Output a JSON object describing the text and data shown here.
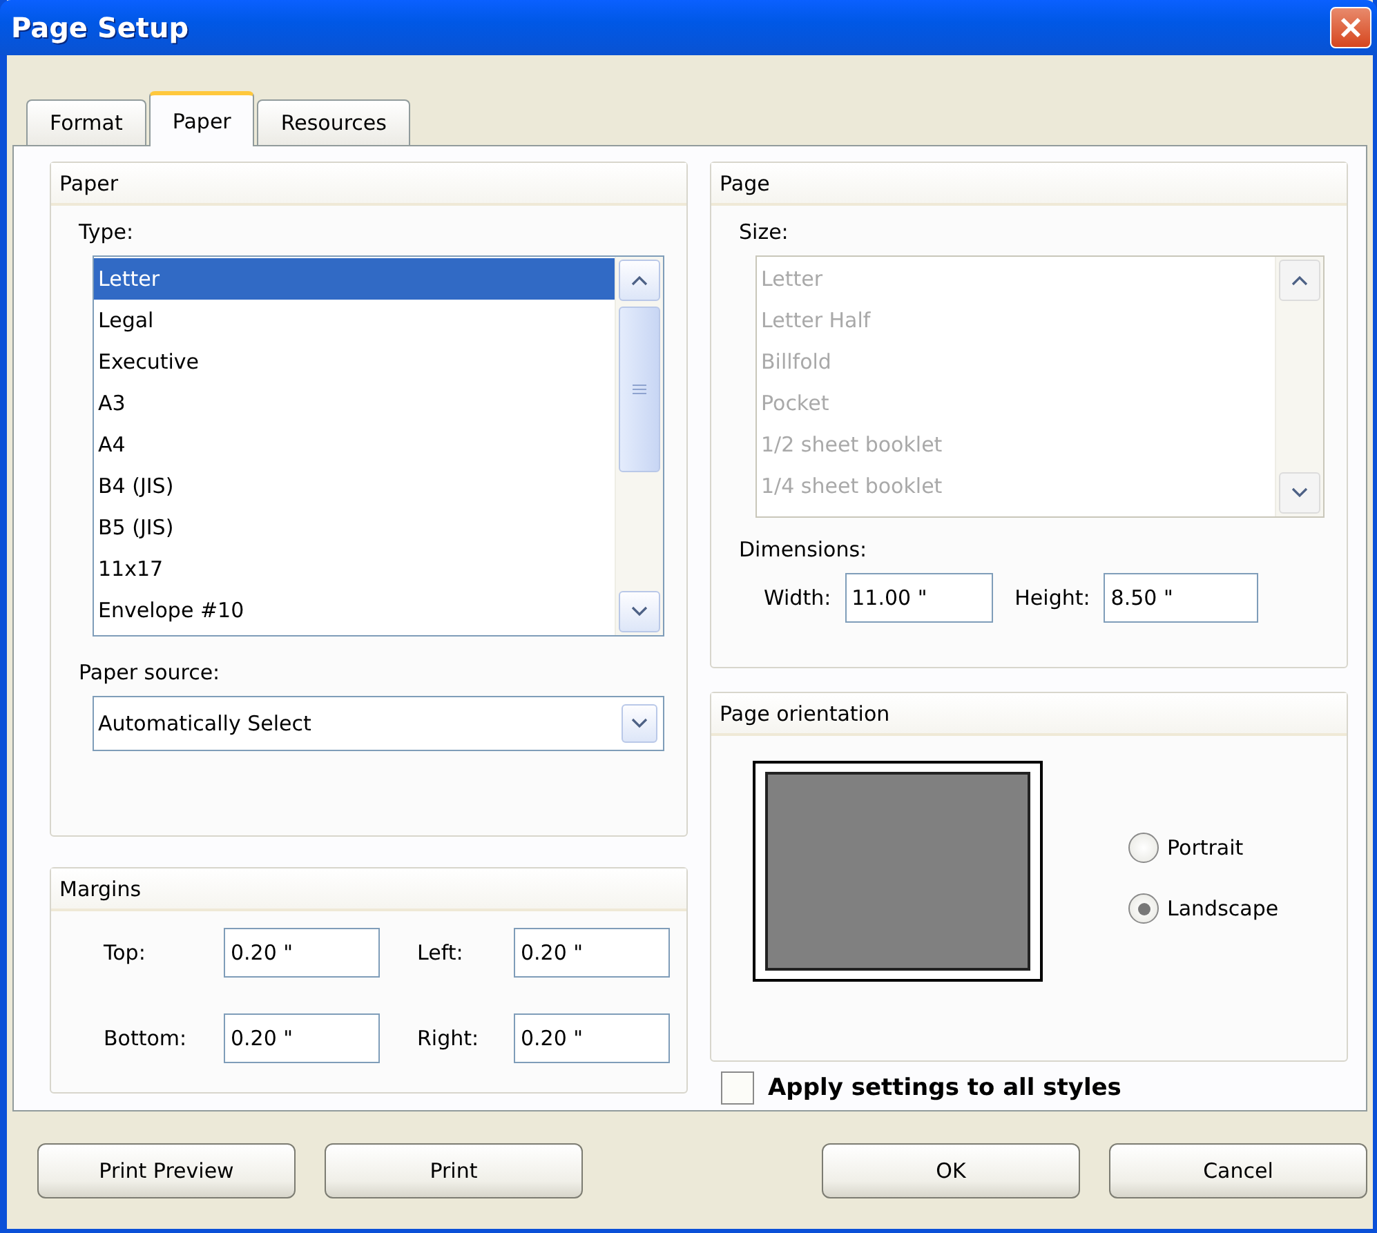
{
  "window": {
    "title": "Page Setup"
  },
  "tabs": [
    {
      "label": "Format",
      "selected": false
    },
    {
      "label": "Paper",
      "selected": true
    },
    {
      "label": "Resources",
      "selected": false
    }
  ],
  "paper": {
    "title": "Paper",
    "type_label": "Type:",
    "types": [
      {
        "label": "Letter",
        "selected": true
      },
      {
        "label": "Legal",
        "selected": false
      },
      {
        "label": "Executive",
        "selected": false
      },
      {
        "label": "A3",
        "selected": false
      },
      {
        "label": "A4",
        "selected": false
      },
      {
        "label": "B4 (JIS)",
        "selected": false
      },
      {
        "label": "B5 (JIS)",
        "selected": false
      },
      {
        "label": "11x17",
        "selected": false
      },
      {
        "label": "Envelope #10",
        "selected": false
      }
    ],
    "source_label": "Paper source:",
    "source_value": "Automatically Select"
  },
  "margins": {
    "title": "Margins",
    "fields": [
      {
        "label": "Top:",
        "value": "0.20 \""
      },
      {
        "label": "Left:",
        "value": "0.20 \""
      },
      {
        "label": "Bottom:",
        "value": "0.20 \""
      },
      {
        "label": "Right:",
        "value": "0.20 \""
      }
    ]
  },
  "page": {
    "title": "Page",
    "size_label": "Size:",
    "sizes_disabled": true,
    "sizes": [
      "Letter",
      "Letter Half",
      "Billfold",
      "Pocket",
      "1/2 sheet booklet",
      "1/4 sheet booklet"
    ],
    "dimensions_label": "Dimensions:",
    "fields": [
      {
        "label": "Width:",
        "value": "11.00 \""
      },
      {
        "label": "Height:",
        "value": "8.50 \""
      }
    ]
  },
  "orientation": {
    "title": "Page orientation",
    "options": [
      {
        "label": "Portrait",
        "selected": false
      },
      {
        "label": "Landscape",
        "selected": true
      }
    ]
  },
  "apply_all": {
    "label": "Apply settings to all styles",
    "checked": false
  },
  "left_buttons": [
    "Print Preview",
    "Print"
  ],
  "right_buttons": [
    "OK",
    "Cancel"
  ]
}
